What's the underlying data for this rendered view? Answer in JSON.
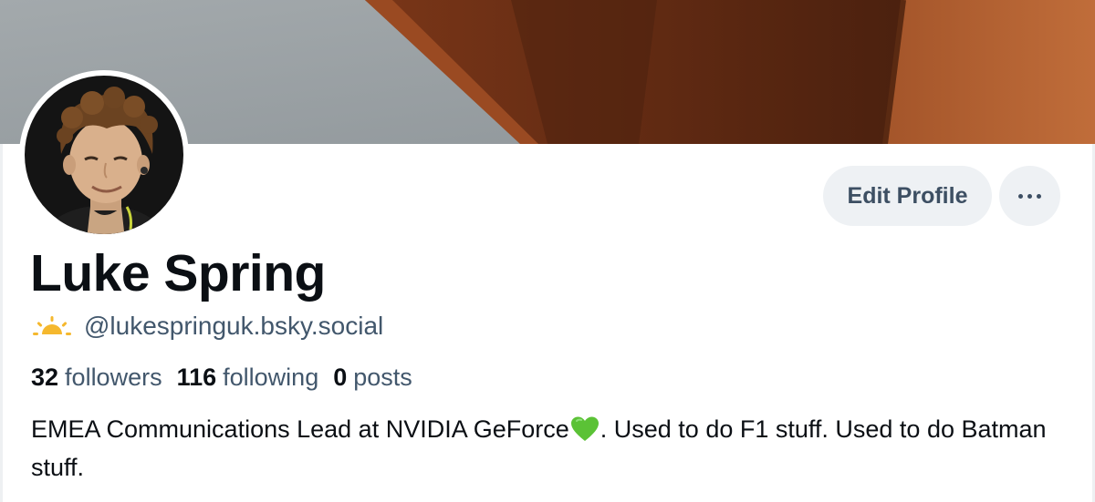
{
  "profile": {
    "display_name": "Luke Spring",
    "handle": "@lukespringuk.bsky.social",
    "handle_icon": "sunrise-icon",
    "stats": {
      "followers_count": "32",
      "followers_label": "followers",
      "following_count": "116",
      "following_label": "following",
      "posts_count": "0",
      "posts_label": "posts"
    },
    "bio_part1": "EMEA Communications Lead at NVIDIA GeForce",
    "bio_emoji": "green-heart-icon",
    "bio_part2": ". Used to do F1 stuff. Used to do Batman stuff."
  },
  "actions": {
    "edit_profile_label": "Edit Profile",
    "more_icon": "ellipsis-icon"
  },
  "colors": {
    "background": "#ffffff",
    "button_bg": "#eef1f4",
    "button_text": "#3d4f63",
    "secondary_text": "#42576c",
    "primary_text": "#0b0f14",
    "heart": "#5bc236",
    "sun": "#f5b82e"
  }
}
